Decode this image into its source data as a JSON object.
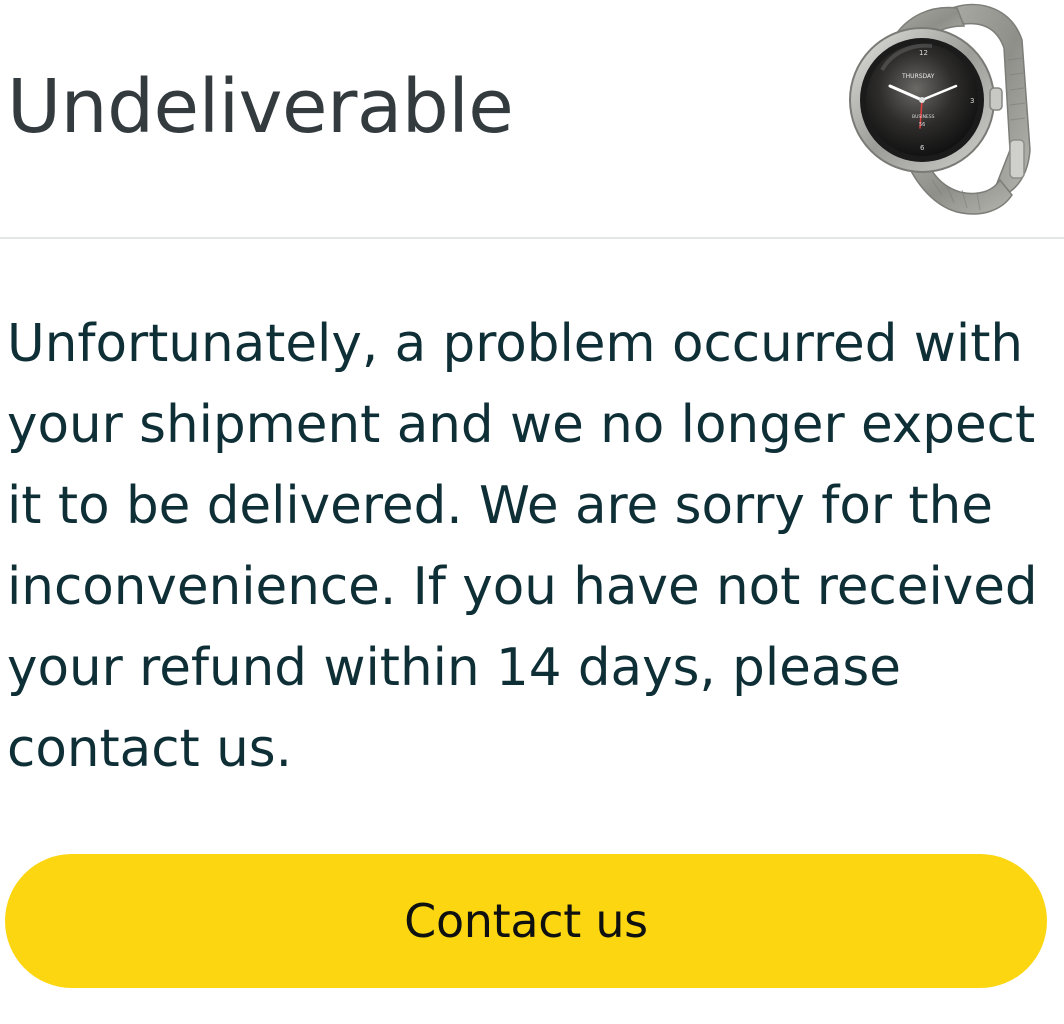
{
  "header": {
    "title": "Undeliverable",
    "product_image": {
      "icon": "smartwatch-icon",
      "face_text_top": "THURSDAY",
      "face_text_mid": "BUSINESS",
      "face_text_small": "56"
    }
  },
  "message": {
    "text": "Unfortunately, a problem occurred with your shipment and we no longer expect it to be delivered. We are sorry for the inconvenience. If you have not received your refund within 14 days, please contact us."
  },
  "actions": {
    "contact_label": "Contact us"
  },
  "colors": {
    "button_background": "#fcd610",
    "title_text": "#333b3f",
    "body_text": "#0f2f37",
    "divider": "#e3e6e6"
  }
}
